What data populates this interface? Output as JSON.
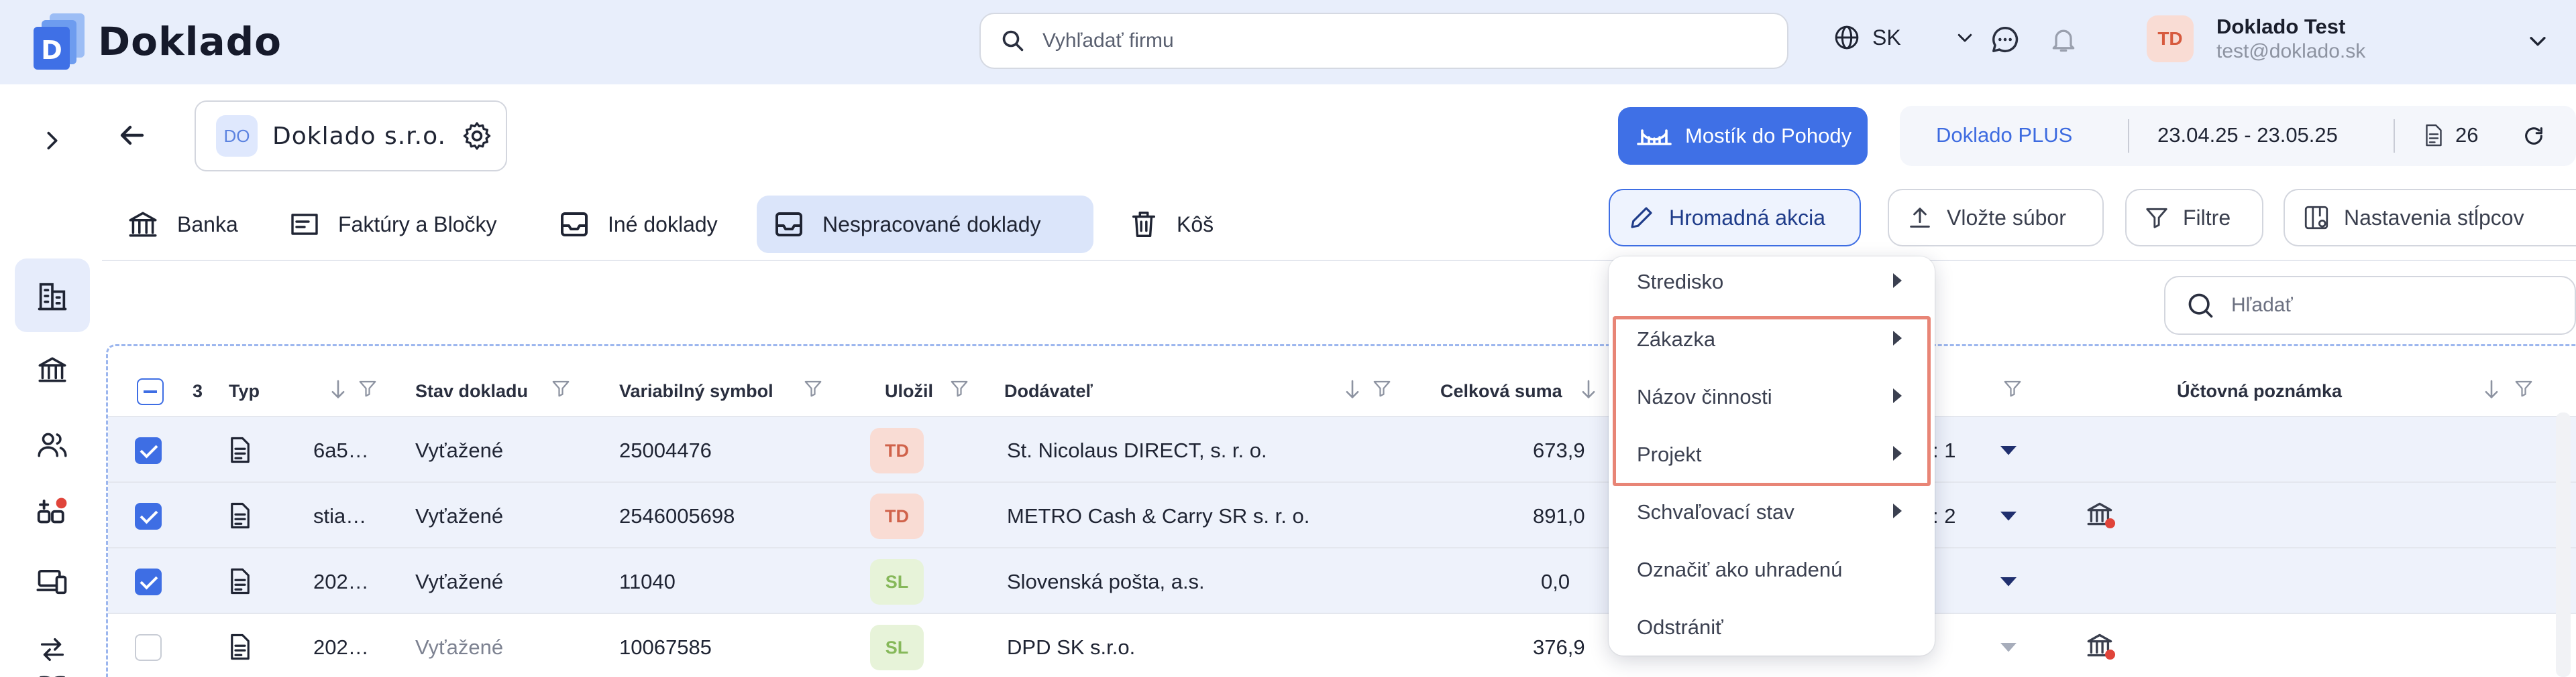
{
  "app": {
    "name": "Doklado",
    "logo_letter": "D"
  },
  "header": {
    "search_placeholder": "Vyhľadať firmu",
    "language": "SK",
    "user": {
      "initials": "TD",
      "name": "Doklado Test",
      "email": "test@doklado.sk"
    }
  },
  "company": {
    "badge": "DO",
    "name": "Doklado s.r.o."
  },
  "actions": {
    "mostik": "Mostík do Pohody",
    "plan": "Doklado PLUS",
    "date_range": "23.04.25 - 23.05.25",
    "doc_count": "26"
  },
  "tabs": [
    {
      "label": "Banka"
    },
    {
      "label": "Faktúry a Bločky"
    },
    {
      "label": "Iné doklady"
    },
    {
      "label": "Nespracované doklady"
    },
    {
      "label": "Kôš"
    }
  ],
  "toolbar": {
    "bulk": "Hromadná akcia",
    "upload": "Vložte súbor",
    "filters": "Filtre",
    "columns": "Nastavenia stĺpcov",
    "search_placeholder": "Hľadať"
  },
  "table": {
    "selected_count": "3",
    "headers": {
      "typ": "Typ",
      "stav": "Stav dokladu",
      "vs": "Variabilný symbol",
      "ulozil": "Uložil",
      "dodavatel": "Dodávateľ",
      "suma": "Celková suma",
      "poznamka": "Účtovná poznámka"
    },
    "rows": [
      {
        "name": "6a5…",
        "status": "Vyťažené",
        "vs": "25004476",
        "user": "TD",
        "supplier": "St. Nicolaus DIRECT, s. r. o.",
        "amount": "673,9",
        "extra": ": 1",
        "checked": true
      },
      {
        "name": "stia…",
        "status": "Vyťažené",
        "vs": "2546005698",
        "user": "TD",
        "supplier": "METRO Cash & Carry SR s. r. o.",
        "amount": "891,0",
        "extra": ": 2",
        "checked": true
      },
      {
        "name": "202…",
        "status": "Vyťažené",
        "vs": "11040",
        "user": "SL",
        "supplier": "Slovenská pošta, a.s.",
        "amount": "0,0",
        "extra": "",
        "checked": true
      },
      {
        "name": "202…",
        "status": "Vyťažené",
        "vs": "10067585",
        "user": "SL",
        "supplier": "DPD SK s.r.o.",
        "amount": "376,9",
        "extra": "",
        "checked": false
      }
    ]
  },
  "bulk_menu": {
    "items": [
      {
        "label": "Stredisko",
        "submenu": true
      },
      {
        "label": "Zákazka",
        "submenu": true
      },
      {
        "label": "Názov činnosti",
        "submenu": true
      },
      {
        "label": "Projekt",
        "submenu": true
      },
      {
        "label": "Schvaľovací stav",
        "submenu": true
      },
      {
        "label": "Označiť ako uhradenú",
        "submenu": false
      },
      {
        "label": "Odstrániť",
        "submenu": false
      }
    ]
  },
  "colors": {
    "accent": "#3f70e6",
    "highlight": "#e88576",
    "badge_td": "#f9dcd4",
    "badge_sl": "#e7f3d9"
  }
}
